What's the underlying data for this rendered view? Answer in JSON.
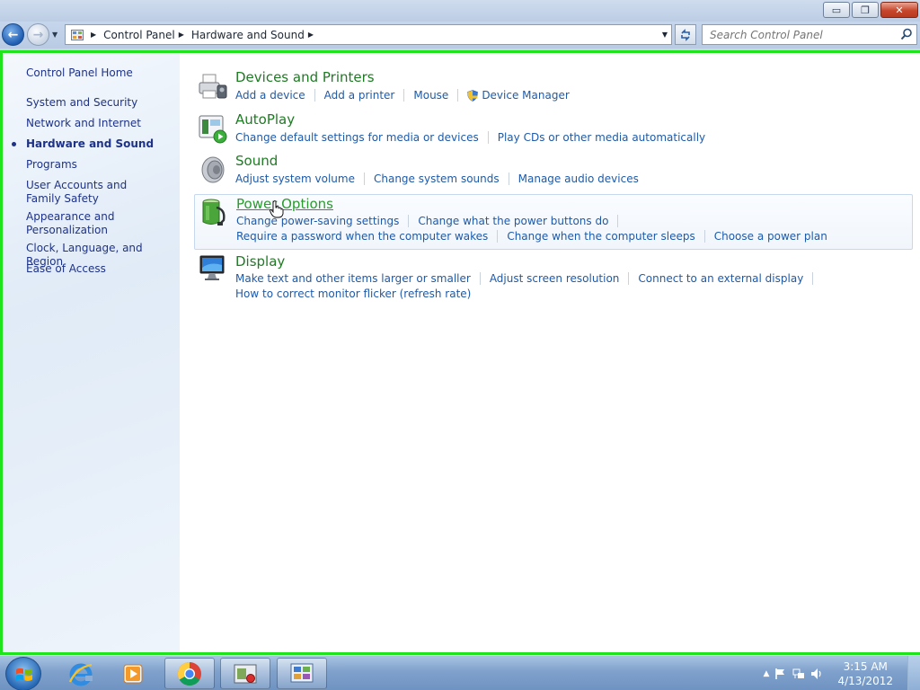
{
  "window": {
    "minimize_glyph": "▭",
    "restore_glyph": "❐",
    "close_glyph": "✕"
  },
  "nav": {
    "back_glyph": "←",
    "forward_glyph": "→",
    "breadcrumbs": [
      "Control Panel",
      "Hardware and Sound"
    ],
    "search_placeholder": "Search Control Panel"
  },
  "sidebar": {
    "home": "Control Panel Home",
    "items": [
      {
        "label": "System and Security",
        "active": false
      },
      {
        "label": "Network and Internet",
        "active": false
      },
      {
        "label": "Hardware and Sound",
        "active": true
      },
      {
        "label": "Programs",
        "active": false
      },
      {
        "label": "User Accounts and Family Safety",
        "active": false
      },
      {
        "label": "Appearance and Personalization",
        "active": false
      },
      {
        "label": "Clock, Language, and Region",
        "active": false
      },
      {
        "label": "Ease of Access",
        "active": false
      }
    ]
  },
  "categories": [
    {
      "title": "Devices and Printers",
      "icon": "printer-icon",
      "rows": [
        [
          "Add a device",
          "Add a printer",
          "Mouse",
          "Device Manager"
        ]
      ]
    },
    {
      "title": "AutoPlay",
      "icon": "autoplay-icon",
      "rows": [
        [
          "Change default settings for media or devices",
          "Play CDs or other media automatically"
        ]
      ]
    },
    {
      "title": "Sound",
      "icon": "speaker-icon",
      "rows": [
        [
          "Adjust system volume",
          "Change system sounds",
          "Manage audio devices"
        ]
      ]
    },
    {
      "title": "Power Options",
      "icon": "battery-icon",
      "rows": [
        [
          "Change power-saving settings",
          "Change what the power buttons do"
        ],
        [
          "Require a password when the computer wakes",
          "Change when the computer sleeps",
          "Choose a power plan"
        ]
      ]
    },
    {
      "title": "Display",
      "icon": "monitor-icon",
      "rows": [
        [
          "Make text and other items larger or smaller",
          "Adjust screen resolution",
          "Connect to an external display"
        ],
        [
          "How to correct monitor flicker (refresh rate)"
        ]
      ]
    }
  ],
  "taskbar": {
    "clock_time": "3:15 AM",
    "clock_date": "4/13/2012",
    "tray_chevron": "▲"
  },
  "colors": {
    "frame_border": "#1de41b",
    "category_title": "#1e7b23",
    "link": "#1e5aa8",
    "sidebar_link": "#1e3287"
  }
}
